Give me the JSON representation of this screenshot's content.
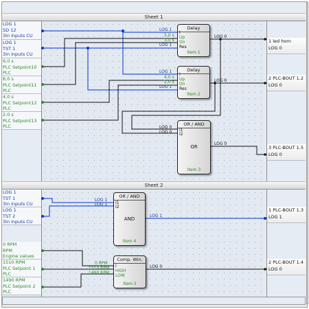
{
  "sheets": [
    {
      "title": "Sheet 1"
    },
    {
      "title": "Sheet 2"
    }
  ],
  "colors": {
    "signal_wire": "#0033cc",
    "plain_wire": "#111111",
    "green_text": "#2d8a24",
    "blue_text": "#1a3a9a"
  },
  "sheet1": {
    "inputs": [
      {
        "lines": [
          "LOG 1",
          "SD 12",
          "3in inputs CU"
        ],
        "color": "blue"
      },
      {
        "lines": [
          "LOG 1",
          "TST 1",
          "3in inputs CU"
        ],
        "color": "blue"
      },
      {
        "lines": [
          "6,0 s",
          "PLC Setpoint10",
          "PLC"
        ],
        "color": "green"
      },
      {
        "lines": [
          "8,0 s",
          "PLC Setpoint11",
          "PLC"
        ],
        "color": "green"
      },
      {
        "lines": [
          "4,0 s",
          "PLC Setpoint12",
          "PLC"
        ],
        "color": "green"
      },
      {
        "lines": [
          "2,0 s",
          "PLC Setpoint13",
          "PLC"
        ],
        "color": "green"
      }
    ],
    "outputs": [
      {
        "lines": [
          "1 led horn",
          "LOG 0"
        ]
      },
      {
        "lines": [
          "2 PLC-BOUT 1.2",
          "LOG 0"
        ]
      },
      {
        "lines": [
          "3 PLC-BOUT 1.5",
          "LOG 0"
        ]
      }
    ],
    "blocks": [
      {
        "title": "Delay",
        "item": "Item 1",
        "pins": [
          "I",
          "Up",
          "Dn",
          "Res"
        ],
        "pin_values": [
          "LOG 1",
          "5,0 s",
          "3,0 s",
          "LOG 1"
        ],
        "output_value": "LOG 0"
      },
      {
        "title": "Delay",
        "item": "Item 2",
        "pins": [
          "I",
          "Up",
          "Dn",
          "Res"
        ],
        "pin_values": [
          "LOG 1",
          "4,0 s",
          "2,0 s",
          "LOG 1"
        ],
        "output_value": "LOG 0"
      },
      {
        "title": "OR / AND",
        "item": "Item 3",
        "function": "OR",
        "pins": [
          "I1",
          "I2"
        ],
        "pin_values": [
          "LOG 0",
          "LOG 0"
        ],
        "output_value": "LOG 0"
      }
    ]
  },
  "sheet2": {
    "inputs": [
      {
        "lines": [
          "LOG 1",
          "TST 1",
          "3in inputs CU"
        ],
        "color": "blue"
      },
      {
        "lines": [
          "LOG 1",
          "TST 2",
          "3in inputs CU"
        ],
        "color": "blue"
      },
      {
        "lines": [
          "0 RPM",
          "RPM",
          "Engine values"
        ],
        "color": "green"
      },
      {
        "lines": [
          "1510 RPM",
          "PLC Setpoint 1",
          "PLC"
        ],
        "color": "green"
      },
      {
        "lines": [
          "1490 RPM",
          "PLC Setpoint 2",
          "PLC"
        ],
        "color": "green"
      }
    ],
    "outputs": [
      {
        "lines": [
          "1 PLC-BOUT 1.3",
          "LOG 1"
        ]
      },
      {
        "lines": [
          "2 PLC-BOUT 1.4",
          "LOG 0"
        ]
      }
    ],
    "blocks": [
      {
        "title": "OR / AND",
        "item": "Item 4",
        "function": "AND",
        "pins": [
          "I1",
          "I2"
        ],
        "pin_values": [
          "LOG 1",
          "LOG 1"
        ],
        "output_value": "LOG 1"
      },
      {
        "title": "Comp. Win.",
        "item": "Item 5",
        "pins": [
          "I",
          "HIGH",
          "LOW"
        ],
        "pin_values": [
          "0 RPM",
          "1510 RPM",
          "1490 RPM"
        ],
        "output_value": "LOG 0"
      }
    ]
  }
}
